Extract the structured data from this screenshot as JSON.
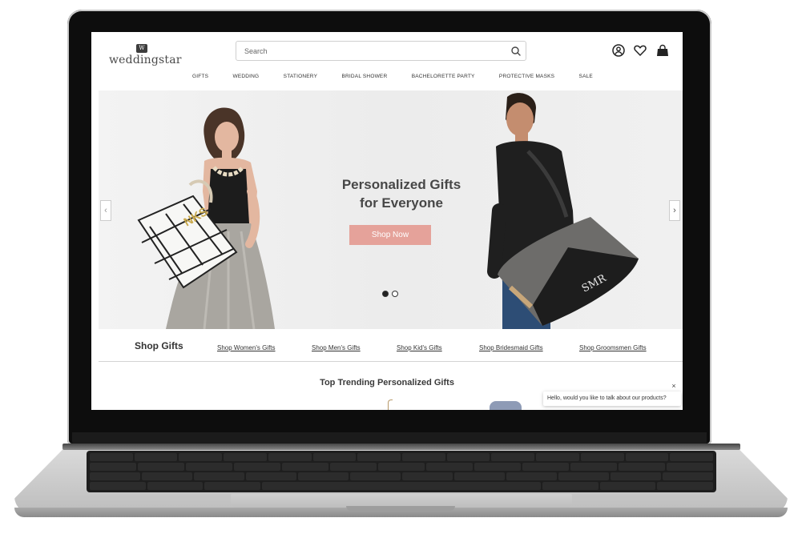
{
  "logo": {
    "badge": "W",
    "text": "weddingstar"
  },
  "search": {
    "placeholder": "Search"
  },
  "header_icons": [
    "account-icon",
    "heart-icon",
    "shopping-bag-icon"
  ],
  "nav": [
    "GIFTS",
    "WEDDING",
    "STATIONERY",
    "BRIDAL SHOWER",
    "BACHELORETTE PARTY",
    "PROTECTIVE MASKS",
    "SALE"
  ],
  "hero": {
    "title_line1": "Personalized Gifts",
    "title_line2": "for Everyone",
    "cta": "Shop Now",
    "tote_monogram": "NKS",
    "duffel_monogram": "SMR",
    "slides": 2,
    "active_slide": 1,
    "prev_arrow": "‹",
    "next_arrow": "›"
  },
  "shop_gifts": {
    "title": "Shop Gifts",
    "links": [
      "Shop Women's Gifts",
      "Shop Men's Gifts",
      "Shop Kid's Gifts",
      "Shop Bridesmaid Gifts",
      "Shop Groomsmen Gifts"
    ]
  },
  "trending": {
    "title": "Top Trending Personalized Gifts"
  },
  "chat": {
    "message": "Hello, would you like to talk about our products?",
    "close": "×"
  },
  "colors": {
    "cta": "#e5a29a",
    "text_dark": "#474747",
    "hero_bg": "#efefef"
  }
}
